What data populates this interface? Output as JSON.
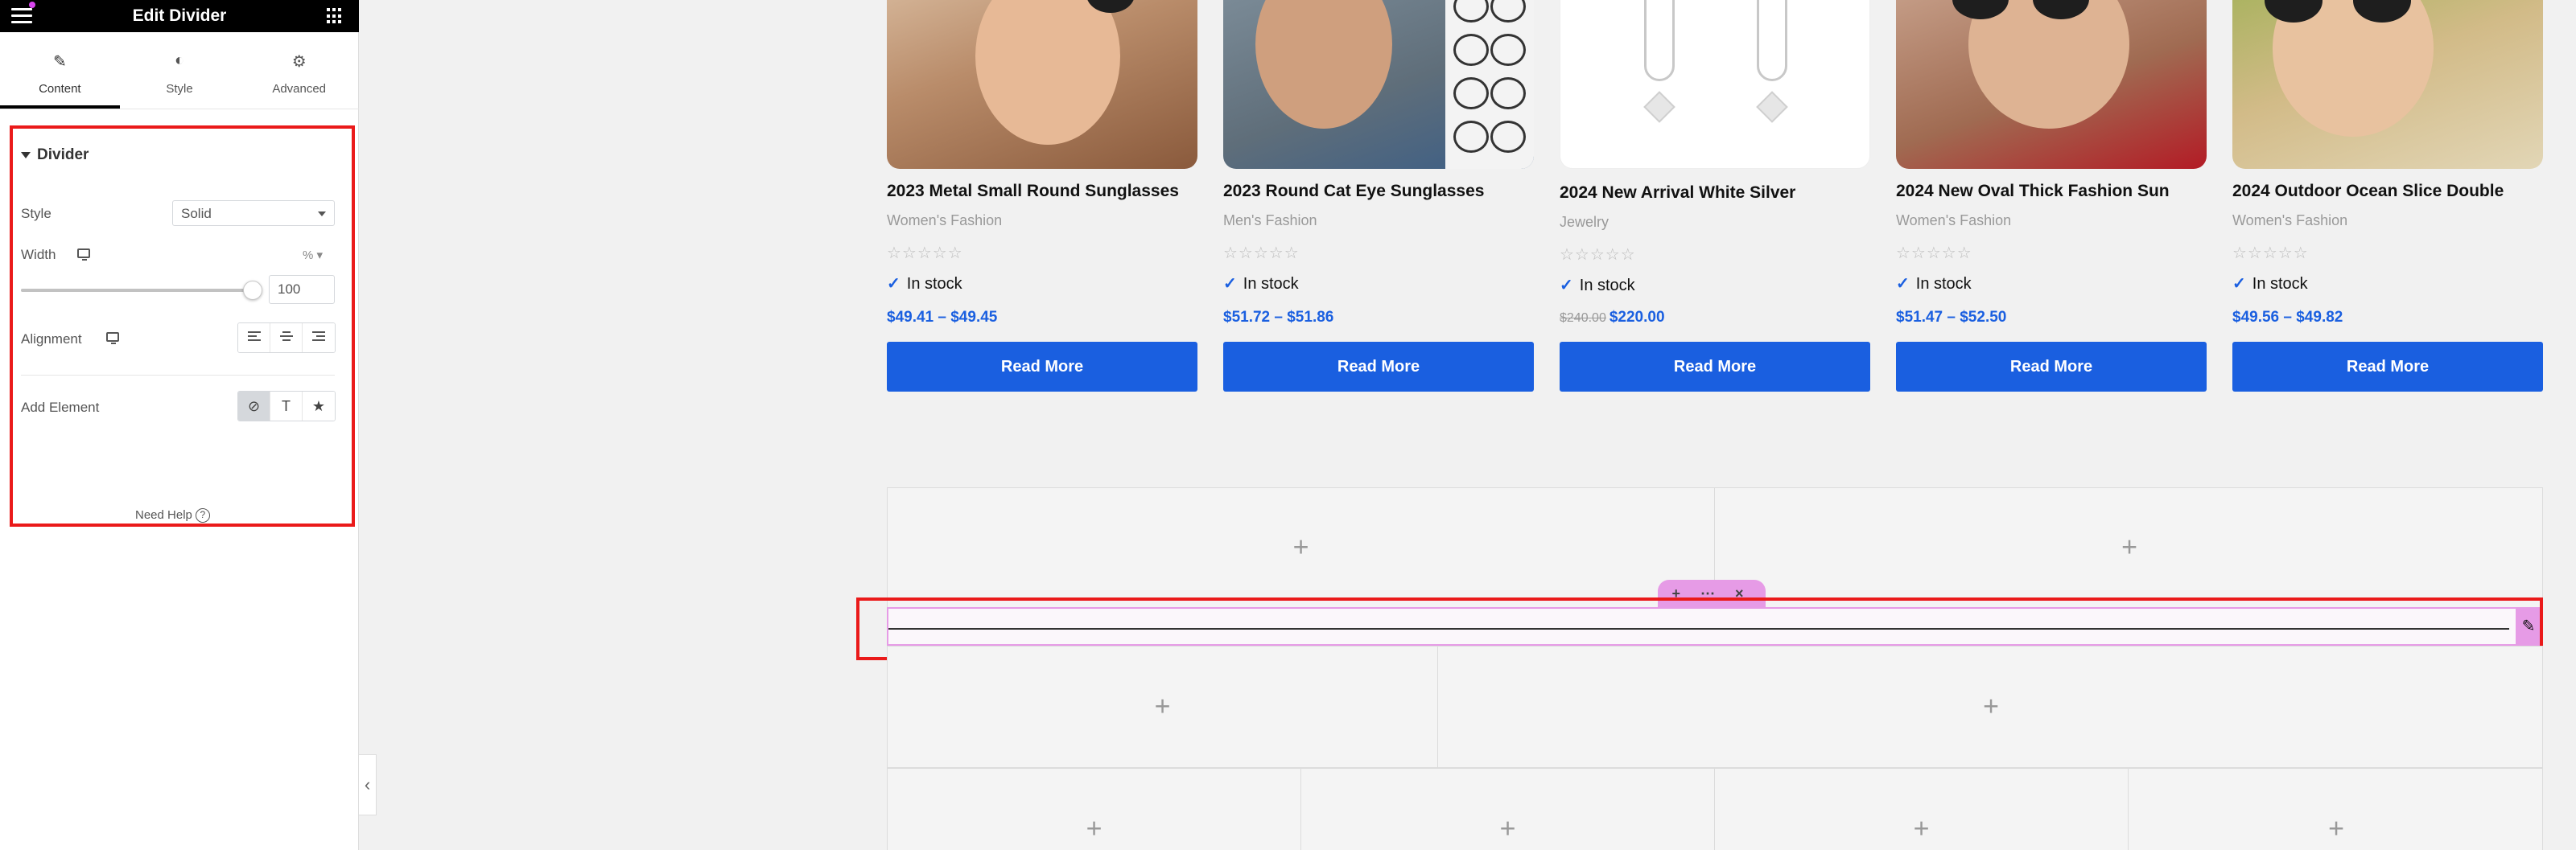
{
  "panel": {
    "title": "Edit Divider",
    "tabs": [
      {
        "label": "Content",
        "icon": "pencil-icon",
        "active": true
      },
      {
        "label": "Style",
        "icon": "half-circle-icon"
      },
      {
        "label": "Advanced",
        "icon": "gear-icon"
      }
    ],
    "section_title": "Divider",
    "style_label": "Style",
    "style_value": "Solid",
    "width_label": "Width",
    "width_unit": "% ▾",
    "width_value": "100",
    "alignment_label": "Alignment",
    "add_element_label": "Add Element",
    "need_help": "Need Help",
    "accent_color": "#ea1a1a"
  },
  "products": [
    {
      "name": "2023 Metal Small Round Sunglasses",
      "category": "Women's Fashion",
      "stars": "☆☆☆☆☆",
      "stock": "In stock",
      "price_old": "",
      "price": "$49.41 – $49.45",
      "button": "Read More"
    },
    {
      "name": "2023 Round Cat Eye Sunglasses",
      "category": "Men's Fashion",
      "stars": "☆☆☆☆☆",
      "stock": "In stock",
      "price_old": "",
      "price": "$51.72 – $51.86",
      "button": "Read More"
    },
    {
      "name": "2024 New Arrival White Silver",
      "category": "Jewelry",
      "stars": "☆☆☆☆☆",
      "stock": "In stock",
      "price_old": "$240.00",
      "price": "$220.00",
      "button": "Read More"
    },
    {
      "name": "2024 New Oval Thick Fashion Sun",
      "category": "Women's Fashion",
      "stars": "☆☆☆☆☆",
      "stock": "In stock",
      "price_old": "",
      "price": "$51.47 – $52.50",
      "button": "Read More"
    },
    {
      "name": "2024 Outdoor Ocean Slice Double",
      "category": "Women's Fashion",
      "stars": "☆☆☆☆☆",
      "stock": "In stock",
      "price_old": "",
      "price": "$49.56 – $49.82",
      "button": "Read More"
    }
  ],
  "canvas": {
    "plus": "+",
    "handle": "+ ⋯ ×",
    "edit_glyph": "✎",
    "brand_blue": "#1a5fe0",
    "widget_pink": "#e69be6"
  }
}
